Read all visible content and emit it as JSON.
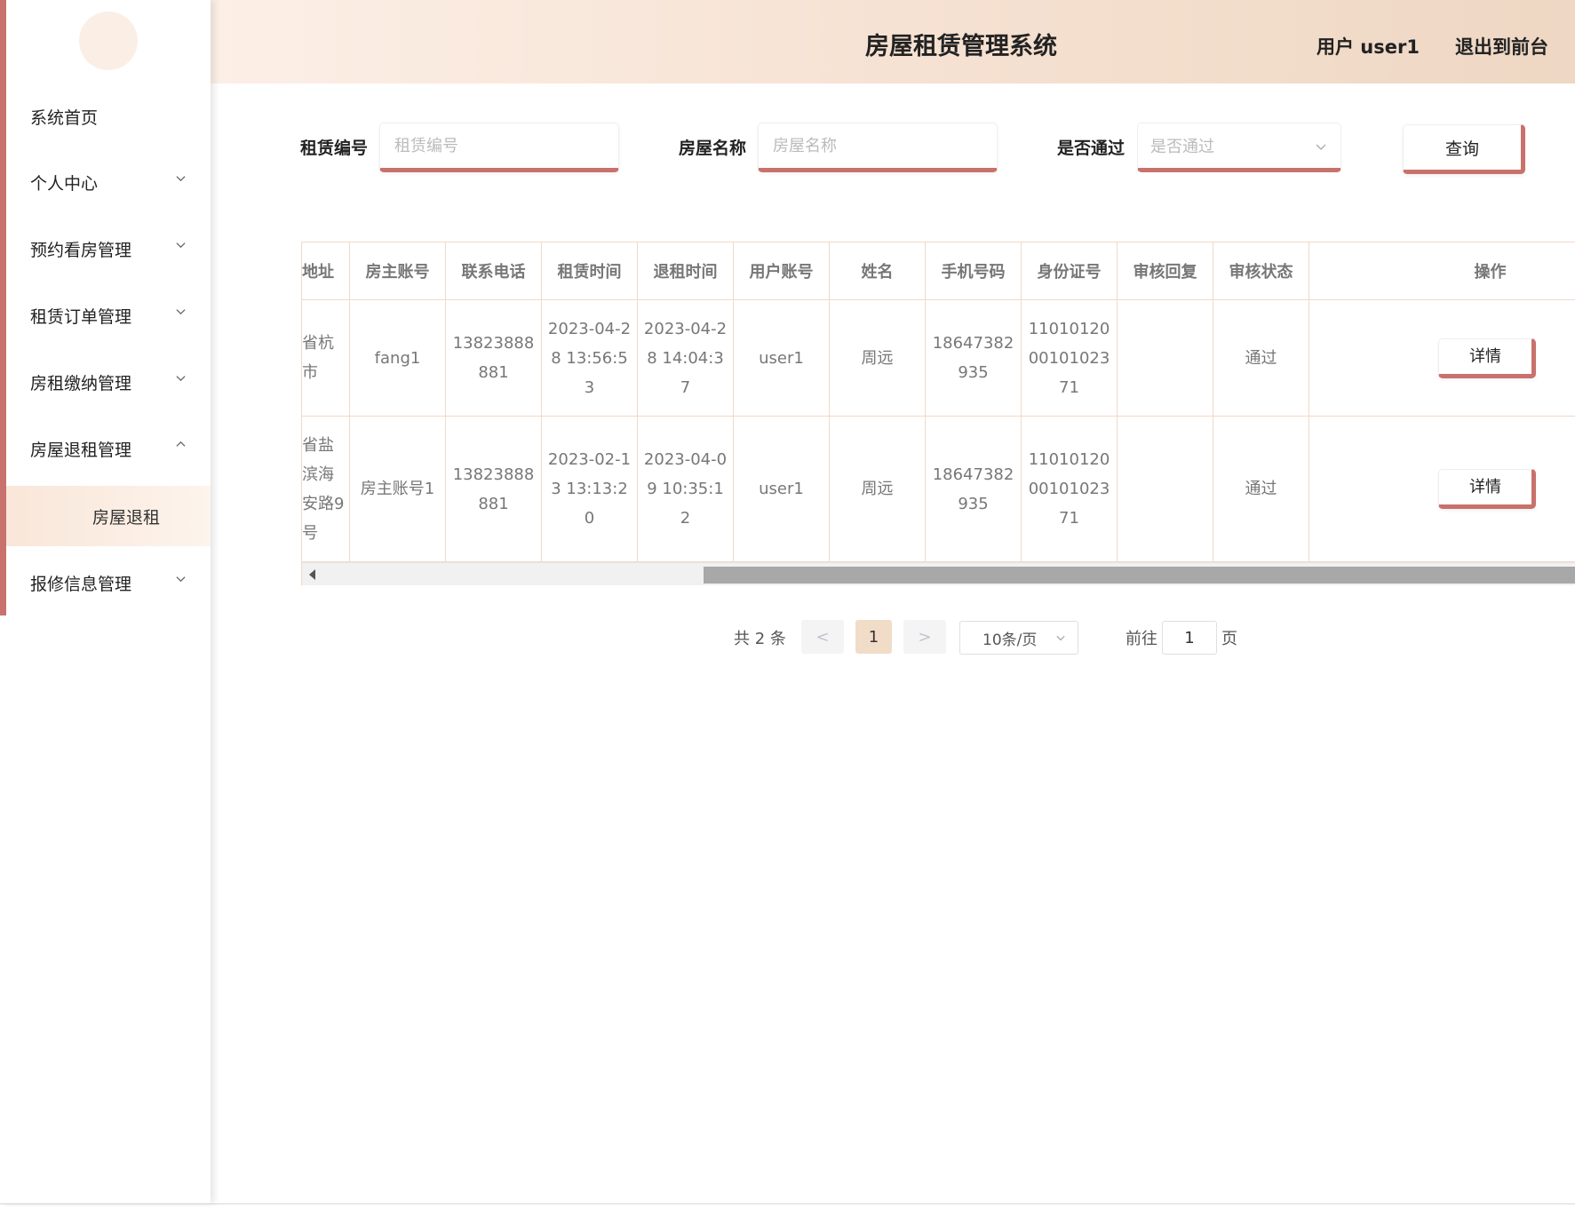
{
  "header": {
    "title": "房屋租赁管理系统",
    "user": "用户 user1",
    "logout": "退出到前台"
  },
  "sidebar": {
    "items": [
      {
        "label": "系统首页",
        "expandable": false
      },
      {
        "label": "个人中心",
        "expandable": true,
        "expanded": false
      },
      {
        "label": "预约看房管理",
        "expandable": true,
        "expanded": false
      },
      {
        "label": "租赁订单管理",
        "expandable": true,
        "expanded": false
      },
      {
        "label": "房租缴纳管理",
        "expandable": true,
        "expanded": false
      },
      {
        "label": "房屋退租管理",
        "expandable": true,
        "expanded": true
      },
      {
        "label": "报修信息管理",
        "expandable": true,
        "expanded": false
      }
    ],
    "active_subitem": "房屋退租"
  },
  "search": {
    "rental_no_label": "租赁编号",
    "rental_no_placeholder": "租赁编号",
    "house_name_label": "房屋名称",
    "house_name_placeholder": "房屋名称",
    "approved_label": "是否通过",
    "approved_placeholder": "是否通过",
    "query_button": "查询"
  },
  "table": {
    "columns": [
      "地址",
      "房主账号",
      "联系电话",
      "租赁时间",
      "退租时间",
      "用户账号",
      "姓名",
      "手机号码",
      "身份证号",
      "审核回复",
      "审核状态",
      "操作"
    ],
    "rows": [
      {
        "address": "省杭市",
        "owner_account": "fang1",
        "phone": "13823888881",
        "rent_time": "2023-04-28 13:56:53",
        "checkout_time": "2023-04-28 14:04:37",
        "user_account": "user1",
        "name": "周远",
        "mobile": "18647382935",
        "id_number": "110101200010102371",
        "review_reply": "",
        "review_status": "通过",
        "action": "详情"
      },
      {
        "address": "省盐滨海安路9号",
        "owner_account": "房主账号1",
        "phone": "13823888881",
        "rent_time": "2023-02-13 13:13:20",
        "checkout_time": "2023-04-09 10:35:12",
        "user_account": "user1",
        "name": "周远",
        "mobile": "18647382935",
        "id_number": "110101200010102371",
        "review_reply": "",
        "review_status": "通过",
        "action": "详情"
      }
    ]
  },
  "pagination": {
    "total": "共 2 条",
    "prev": "<",
    "current_page": "1",
    "next": ">",
    "page_size": "10条/页",
    "goto_label": "前往",
    "goto_value": "1",
    "goto_suffix": "页"
  },
  "colors": {
    "accent": "#c9716c",
    "header_gradient_start": "#fcefe6",
    "header_gradient_end": "#eed7c3",
    "active_page": "#f1dcc8"
  }
}
